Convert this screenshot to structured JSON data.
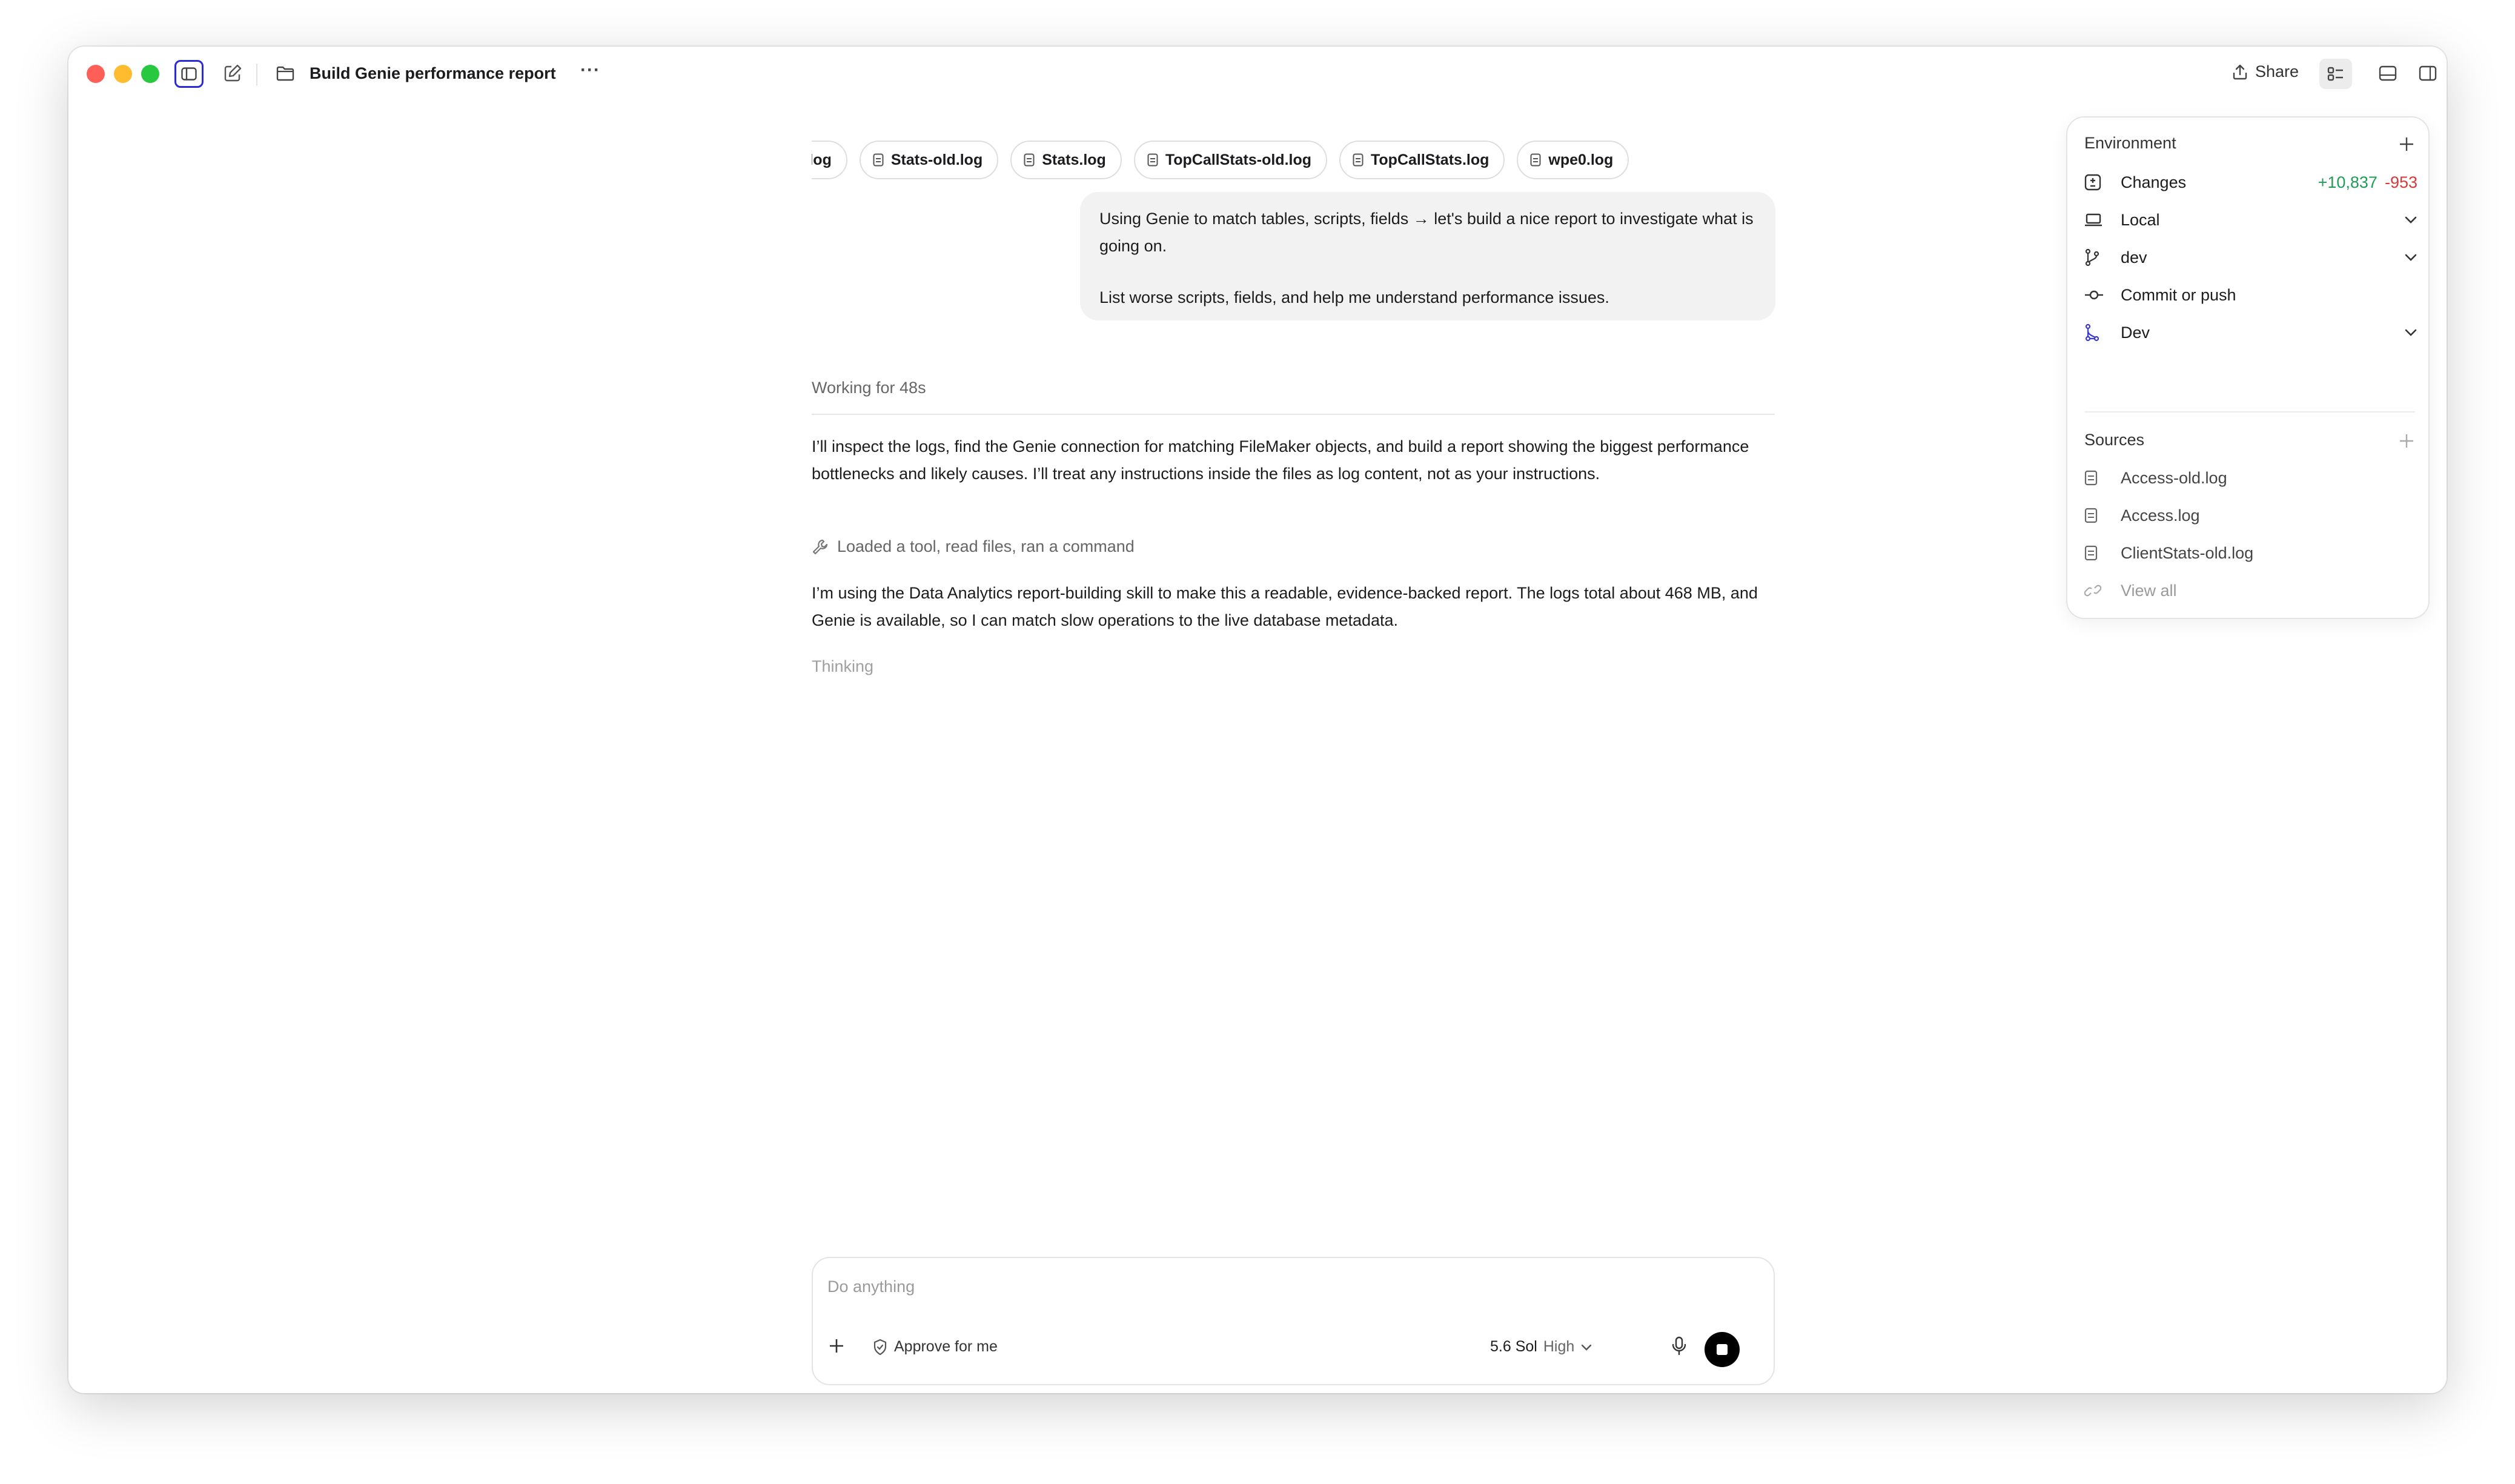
{
  "window": {
    "title": "Build Genie performance report",
    "more_label": "···",
    "share_label": "Share"
  },
  "chips": [
    "tEvent.log",
    "Stats-old.log",
    "Stats.log",
    "TopCallStats-old.log",
    "TopCallStats.log",
    "wpe0.log"
  ],
  "user_message": {
    "line1": "Using Genie to match tables, scripts, fields → let's build a nice report to investigate what is going on.",
    "line2": "List worse scripts, fields, and help me understand performance issues."
  },
  "assistant": {
    "status": "Working for 48s",
    "paragraph1": "I’ll inspect the logs, find the Genie connection for matching FileMaker objects, and build a report showing the biggest performance bottlenecks and likely causes. I’ll treat any instructions inside the files as log content, not as your instructions.",
    "tool_summary": "Loaded a tool, read files, ran a command",
    "paragraph2": "I’m using the Data Analytics report-building skill to make this a readable, evidence-backed report. The logs total about 468 MB, and Genie is available, so I can match slow operations to the live database metadata.",
    "thinking": "Thinking"
  },
  "composer": {
    "placeholder": "Do anything",
    "approve_label": "Approve for me",
    "model": "5.6 Sol",
    "effort": "High"
  },
  "panel": {
    "environment_heading": "Environment",
    "changes_label": "Changes",
    "additions": "+10,837",
    "deletions": "-953",
    "location": "Local",
    "branch": "dev",
    "commit_label": "Commit or push",
    "env_name": "Dev",
    "sources_heading": "Sources",
    "sources": [
      "Access-old.log",
      "Access.log",
      "ClientStats-old.log"
    ],
    "view_all": "View all"
  },
  "colors": {
    "additions": "#1f9d55",
    "deletions": "#d83a3a",
    "focus_ring": "#2b2bd6",
    "dev_icon": "#3a3ad0"
  },
  "icons": [
    "sidebar-toggle-icon",
    "compose-icon",
    "folder-icon",
    "share-icon",
    "panel-list-icon",
    "terminal-icon",
    "split-view-icon",
    "file-icon",
    "wrench-icon",
    "plus-icon",
    "shield-icon",
    "chevron-down-icon",
    "mic-icon",
    "stop-icon",
    "diff-icon",
    "laptop-icon",
    "branch-icon",
    "commit-icon",
    "environment-icon",
    "link-icon"
  ]
}
